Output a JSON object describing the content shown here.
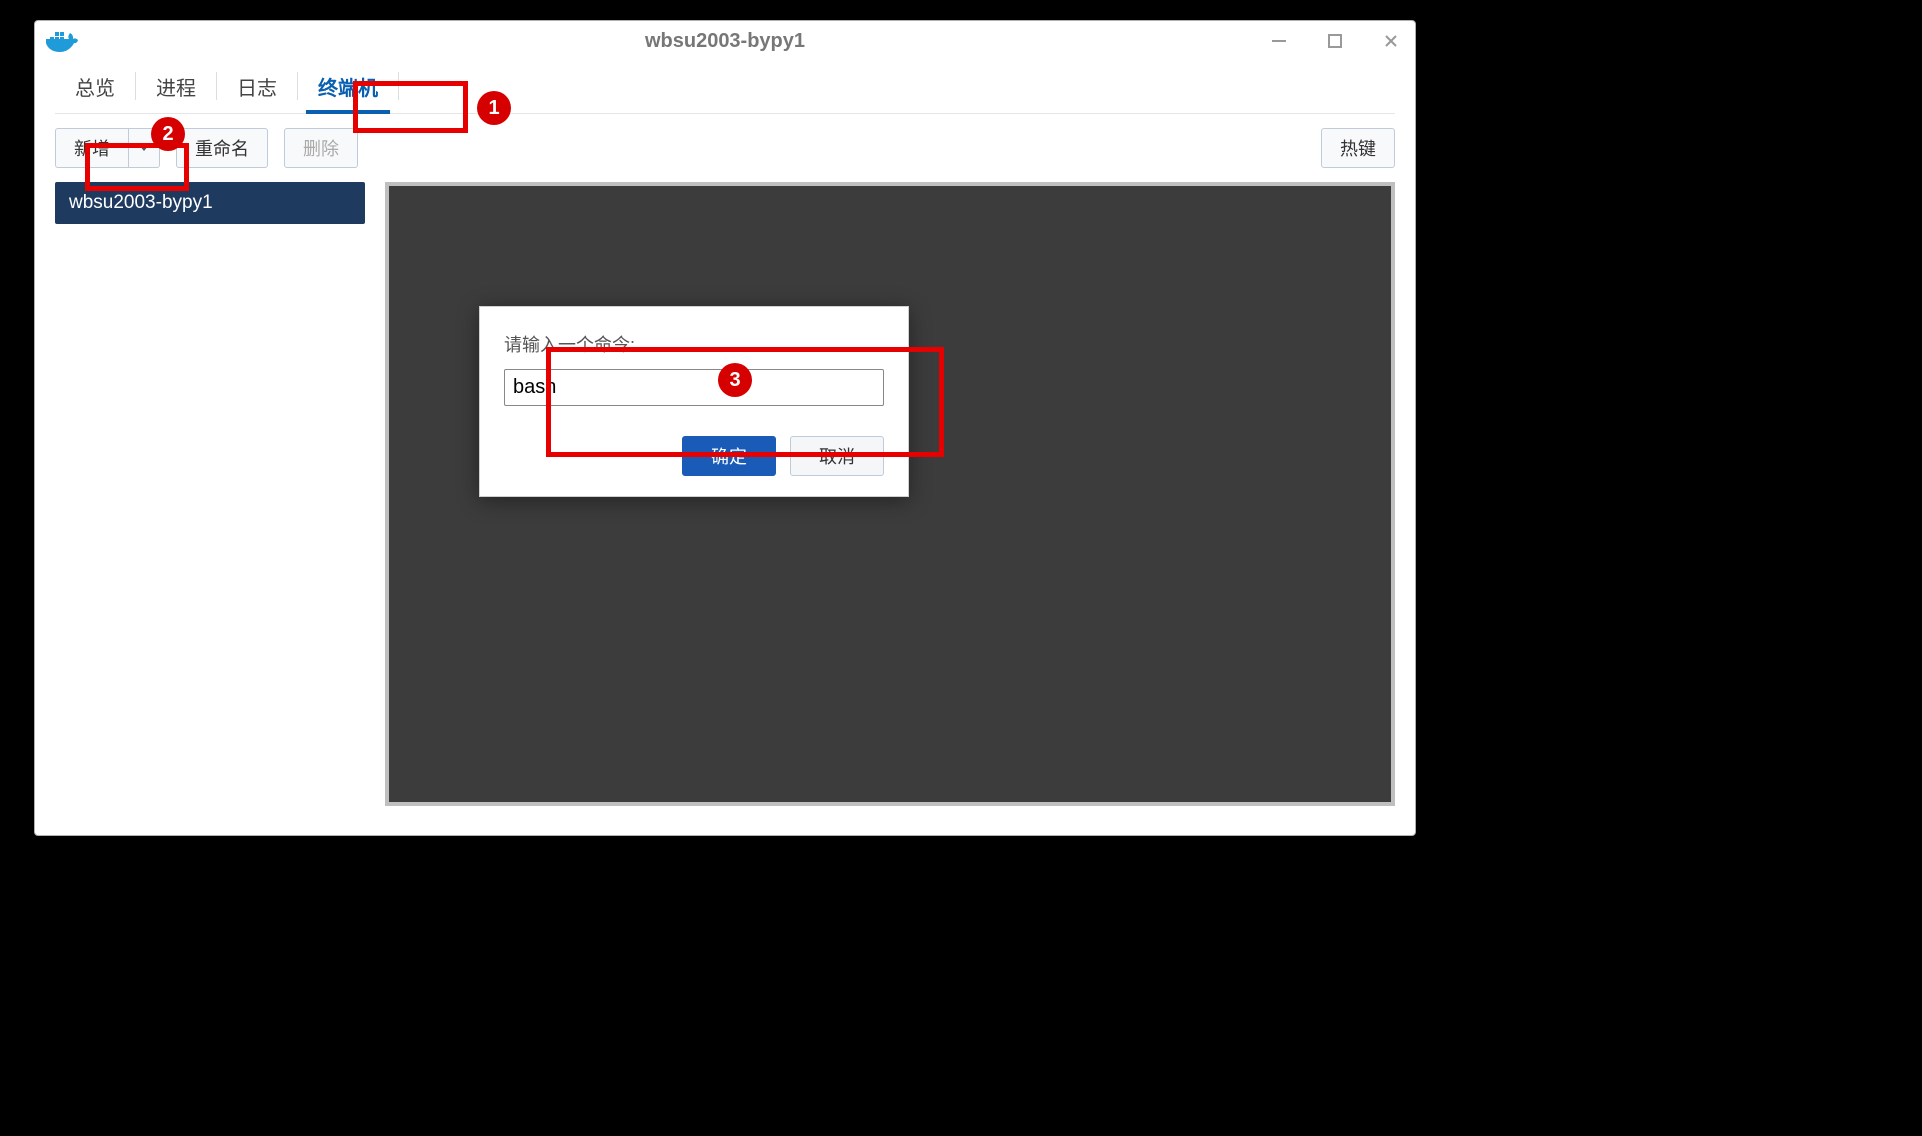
{
  "window": {
    "title": "wbsu2003-bypy1"
  },
  "tabs": {
    "overview": "总览",
    "process": "进程",
    "logs": "日志",
    "terminal": "终端机"
  },
  "toolbar": {
    "add": "新增",
    "rename": "重命名",
    "delete": "删除",
    "hotkeys": "热键"
  },
  "sidebar": {
    "items": [
      {
        "label": "wbsu2003-bypy1"
      }
    ]
  },
  "dialog": {
    "label": "请输入一个命令:",
    "input_value": "bash",
    "ok": "确定",
    "cancel": "取消"
  },
  "annotations": {
    "a1": "1",
    "a2": "2",
    "a3": "3"
  }
}
